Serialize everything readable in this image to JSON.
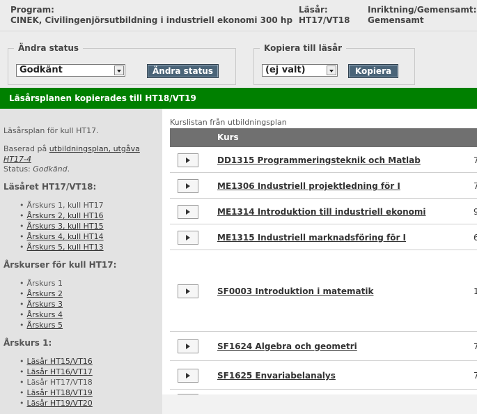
{
  "header": {
    "program_label": "Program:",
    "program_value": "CINEK, Civilingenjörsutbildning i industriell ekonomi 300 hp",
    "year_label": "Läsår:",
    "year_value": "HT17/VT18",
    "direction_label": "Inriktning/Gemensamt:",
    "direction_value": "Gemensamt"
  },
  "change_status": {
    "legend": "Ändra status",
    "selected": "Godkänt",
    "button": "Ändra status"
  },
  "copy_year": {
    "legend": "Kopiera till läsår",
    "selected": "(ej valt)",
    "button": "Kopiera"
  },
  "banner": "Läsårsplanen kopierades till HT18/VT19",
  "sidebar": {
    "plan_text": "Läsårsplan för kull HT17.",
    "based_on_prefix": "Baserad på ",
    "based_on_link_1": "utbildningsplan, utgåva",
    "based_on_link_2": "HT17-4",
    "status_prefix": "Status: ",
    "status_value": "Godkänd",
    "status_suffix": ".",
    "year_heading": "Läsåret HT17/VT18:",
    "year_items": [
      {
        "label": "Årskurs 1, kull HT17",
        "link": false
      },
      {
        "label": "Årskurs 2, kull HT16",
        "link": true
      },
      {
        "label": "Årskurs 3, kull HT15",
        "link": true
      },
      {
        "label": "Årskurs 4, kull HT14",
        "link": true
      },
      {
        "label": "Årskurs 5, kull HT13",
        "link": true
      }
    ],
    "courses_heading": "Årskurser för kull HT17:",
    "course_items": [
      {
        "label": "Årskurs 1",
        "link": false
      },
      {
        "label": "Årskurs 2",
        "link": true
      },
      {
        "label": "Årskurs 3",
        "link": true
      },
      {
        "label": "Årskurs 4",
        "link": true
      },
      {
        "label": "Årskurs 5",
        "link": true
      }
    ],
    "grade1_heading": "Årskurs 1:",
    "grade1_items": [
      {
        "label": "Läsår HT15/VT16",
        "link": true
      },
      {
        "label": "Läsår HT16/VT17",
        "link": true
      },
      {
        "label": "Läsår HT17/VT18",
        "link": false
      },
      {
        "label": "Läsår HT18/VT19",
        "link": true
      },
      {
        "label": "Läsår HT19/VT20",
        "link": true
      }
    ]
  },
  "course_list": {
    "caption": "Kurslistan från utbildningsplan",
    "column_header": "Kurs",
    "rows": [
      {
        "name": "DD1315 Programmeringsteknik och Matlab",
        "num": "7"
      },
      {
        "name": "ME1306 Industriell projektledning för I",
        "num": "7"
      },
      {
        "name": "ME1314 Introduktion till industriell ekonomi",
        "num": "9"
      },
      {
        "name": "ME1315 Industriell marknadsföring för I",
        "num": "6"
      },
      {
        "name": "SF0003 Introduktion i matematik",
        "num": "1"
      },
      {
        "name": "SF1624 Algebra och geometri",
        "num": "7"
      },
      {
        "name": "SF1625 Envariabelanalys",
        "num": "7"
      }
    ]
  }
}
